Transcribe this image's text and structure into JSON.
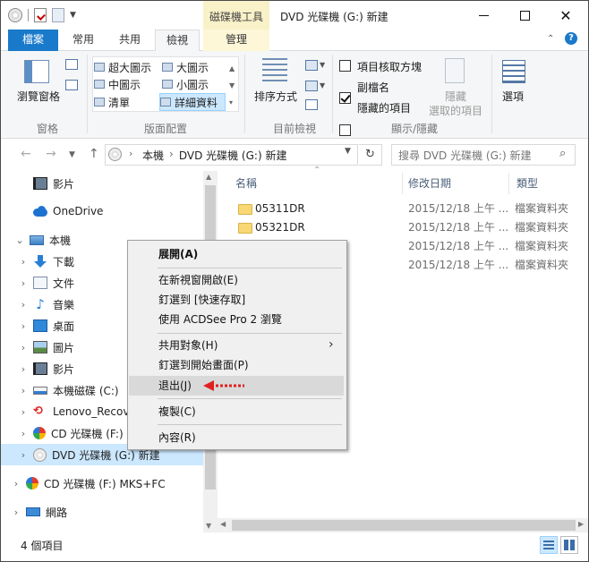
{
  "window": {
    "context_tab": "磁碟機工具",
    "title": "DVD 光碟機 (G:) 新建"
  },
  "tabs": [
    {
      "label": "檔案"
    },
    {
      "label": "常用"
    },
    {
      "label": "共用"
    },
    {
      "label": "檢視"
    },
    {
      "label": "管理"
    }
  ],
  "ribbon": {
    "pane": {
      "nav_label": "瀏覽窗格",
      "group": "窗格"
    },
    "layout": {
      "items": [
        "超大圖示",
        "大圖示",
        "中圖示",
        "小圖示",
        "清單",
        "詳細資料"
      ],
      "selected": "詳細資料",
      "group": "版面配置"
    },
    "current_view": {
      "sort_label": "排序方式",
      "group": "目前檢視"
    },
    "show_hide": {
      "item_checkboxes": "項目核取方塊",
      "extensions": "副檔名",
      "hidden_items": "隱藏的項目",
      "extensions_checked": true,
      "hide_selected_1": "隱藏",
      "hide_selected_2": "選取的項目",
      "group": "顯示/隱藏"
    },
    "options_label": "選項"
  },
  "address": {
    "path_root": "本機",
    "path_drive": "DVD 光碟機 (G:) 新建",
    "search_placeholder": "搜尋 DVD 光碟機 (G:) 新建"
  },
  "nav": [
    {
      "label": "影片",
      "icon": "film-icon"
    },
    {
      "label": "OneDrive",
      "icon": "onedrive-icon"
    },
    {
      "label": "本機",
      "icon": "pc-icon"
    },
    {
      "label": "下載",
      "icon": "download-icon"
    },
    {
      "label": "文件",
      "icon": "documents-icon"
    },
    {
      "label": "音樂",
      "icon": "music-icon"
    },
    {
      "label": "桌面",
      "icon": "desktop-icon"
    },
    {
      "label": "圖片",
      "icon": "pictures-icon"
    },
    {
      "label": "影片",
      "icon": "film-icon"
    },
    {
      "label": "本機磁碟 (C:)",
      "icon": "hard-drive-icon"
    },
    {
      "label": "Lenovo_Recov",
      "icon": "recovery-drive-icon"
    },
    {
      "label": "CD 光碟機 (F:)",
      "icon": "cd-drive-icon"
    },
    {
      "label": "DVD 光碟機 (G:) 新建",
      "icon": "dvd-drive-icon"
    },
    {
      "label": "CD 光碟機 (F:) MKS+FC",
      "icon": "cd-drive-icon"
    },
    {
      "label": "網路",
      "icon": "network-icon"
    }
  ],
  "columns": {
    "name": "名稱",
    "date": "修改日期",
    "type": "類型"
  },
  "files": [
    {
      "name": "05311DR",
      "date": "2015/12/18 上午 ...",
      "type": "檔案資料夾"
    },
    {
      "name": "05321DR",
      "date": "2015/12/18 上午 ...",
      "type": "檔案資料夾"
    },
    {
      "name": "",
      "date": "2015/12/18 上午 ...",
      "type": "檔案資料夾"
    },
    {
      "name": "",
      "date": "2015/12/18 上午 ...",
      "type": "檔案資料夾"
    }
  ],
  "status": {
    "count": "4 個項目"
  },
  "menu": {
    "items": [
      {
        "label": "展開(A)",
        "bold": true
      },
      {
        "label": "在新視窗開啟(E)"
      },
      {
        "label": "釘選到 [快速存取]"
      },
      {
        "label": "使用 ACDSee Pro 2 瀏覽"
      },
      {
        "label": "共用對象(H)",
        "submenu": true
      },
      {
        "label": "釘選到開始畫面(P)"
      },
      {
        "label": "退出(J)",
        "highlighted": true
      },
      {
        "label": "複製(C)"
      },
      {
        "label": "內容(R)"
      }
    ]
  },
  "colors": {
    "accent": "#1979ca",
    "selection": "#cce8ff",
    "context_tab": "#f9f1c8",
    "arrow": "#e02020"
  }
}
